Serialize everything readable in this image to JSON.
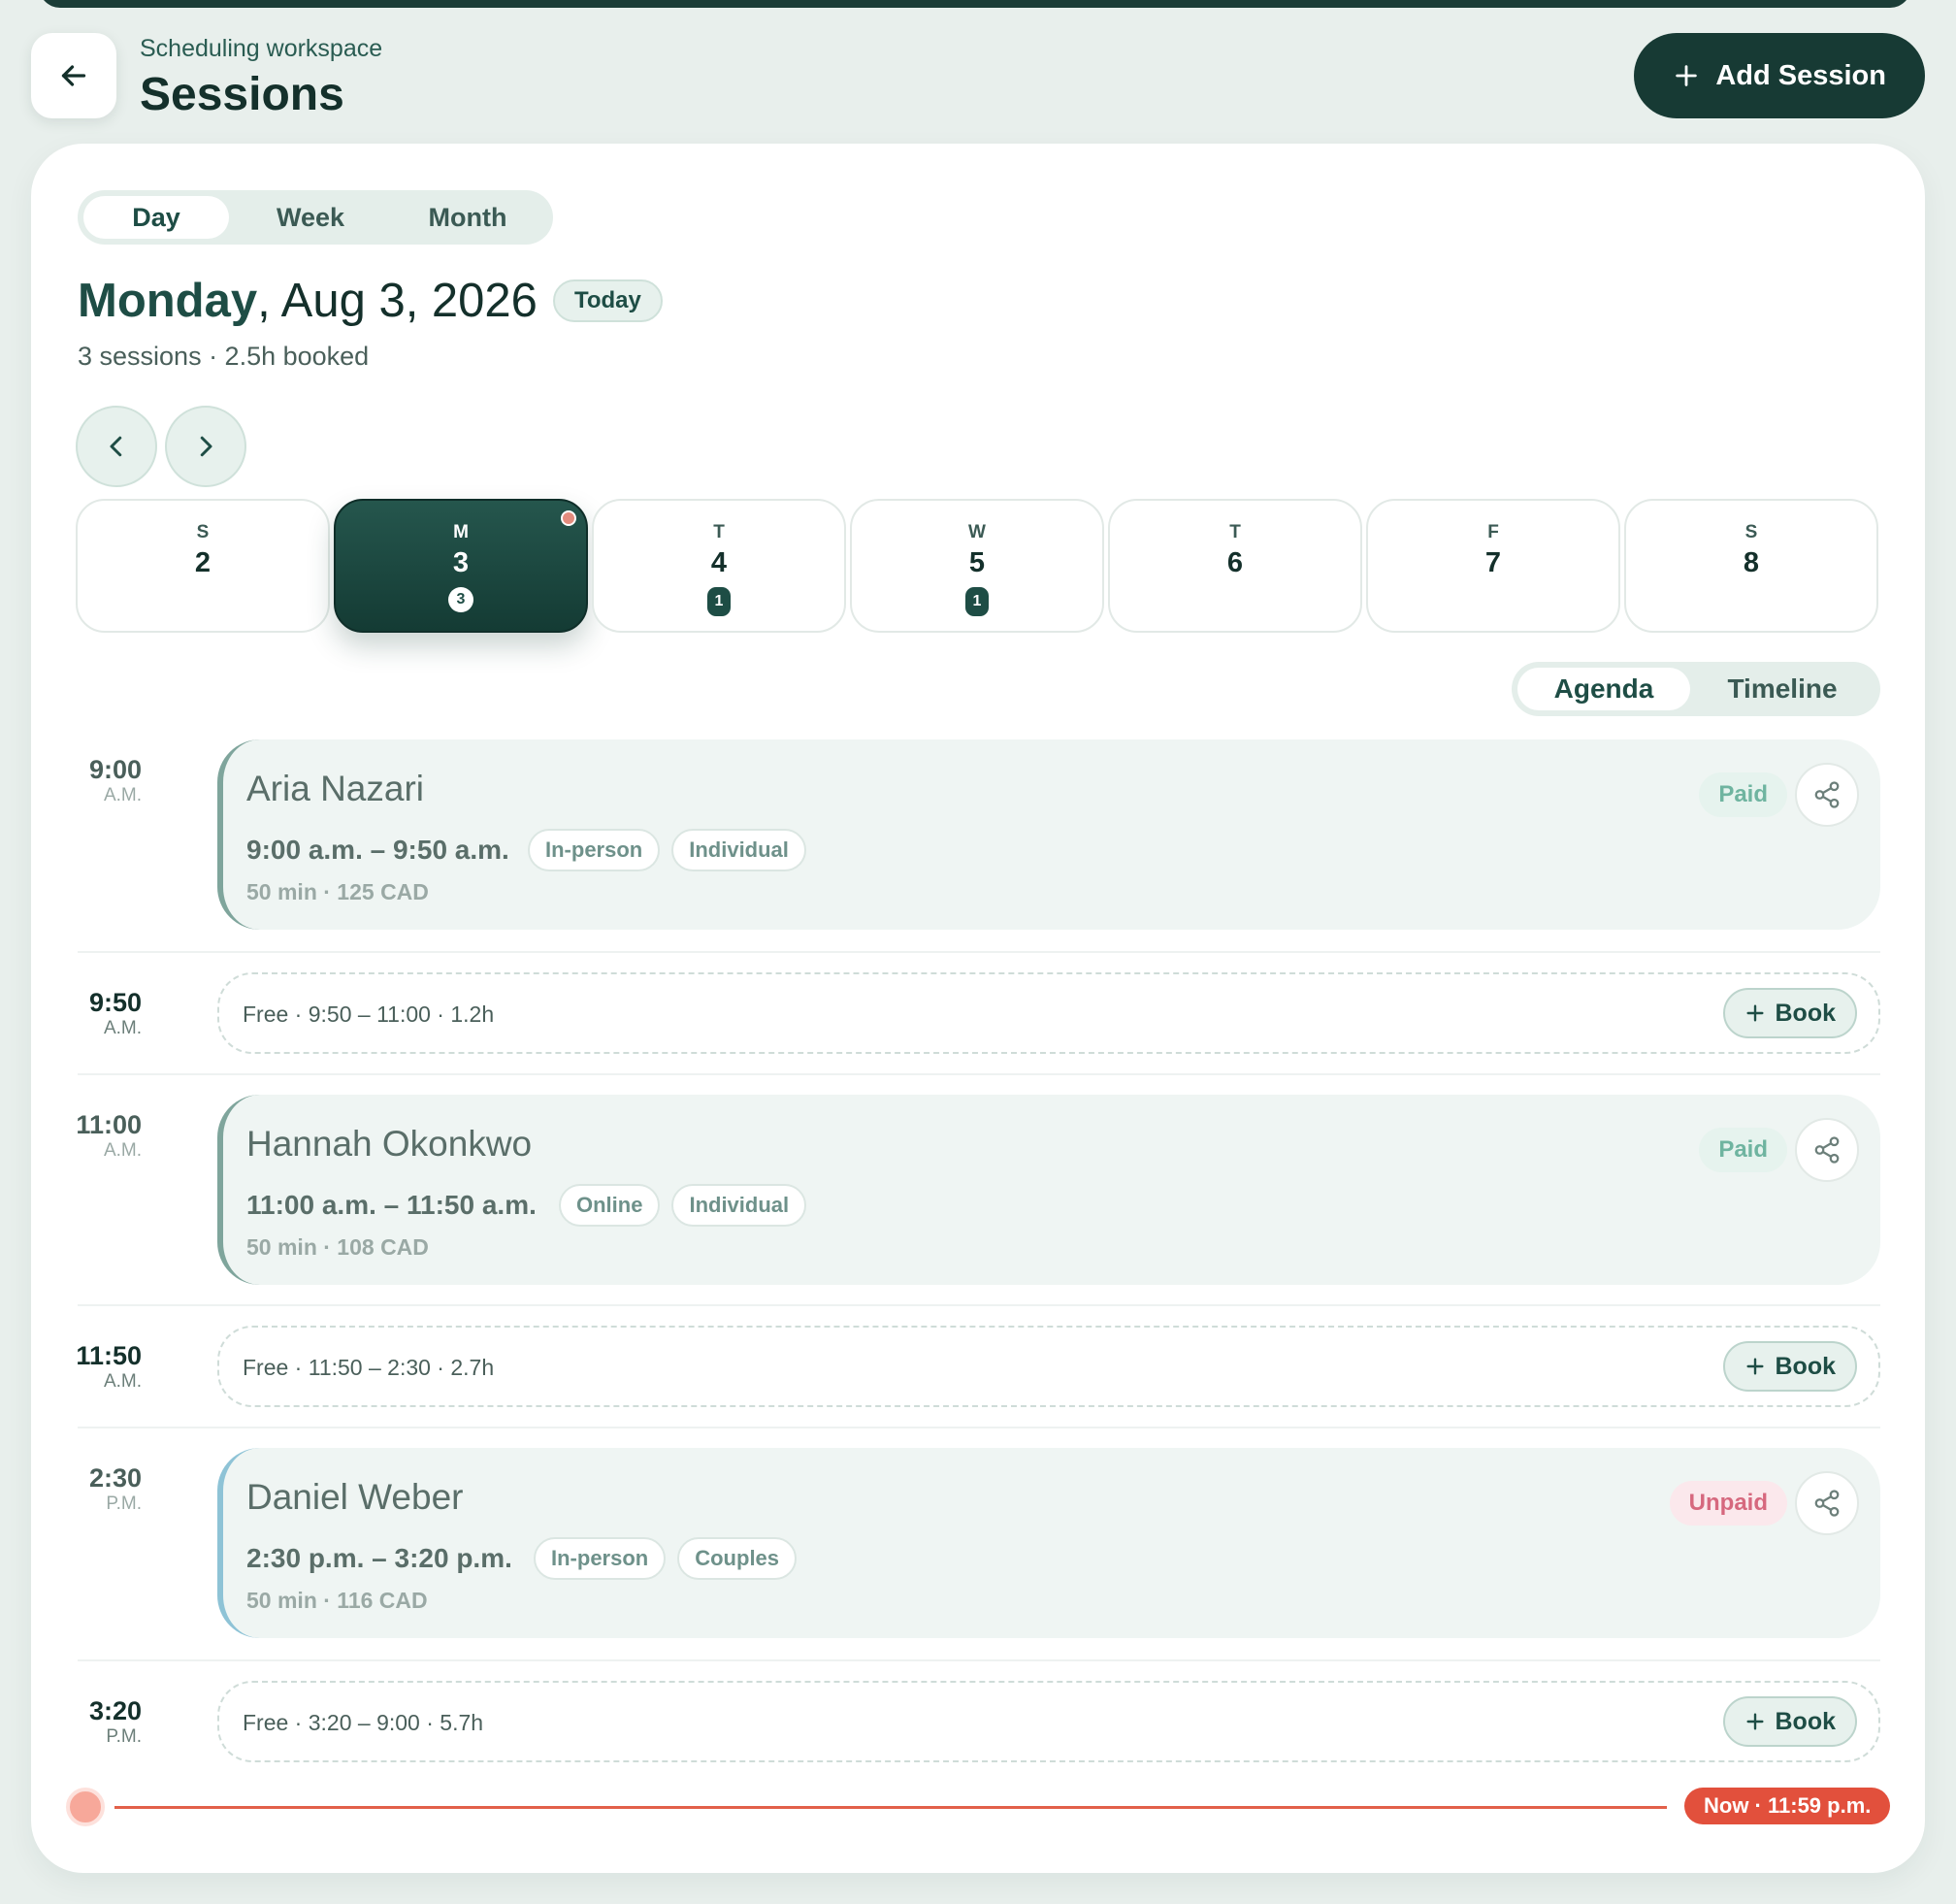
{
  "header": {
    "workspace": "Scheduling workspace",
    "title": "Sessions",
    "add_session_label": "Add Session"
  },
  "view_switch": {
    "day": "Day",
    "week": "Week",
    "month": "Month",
    "selected": "Day"
  },
  "date": {
    "weekday": "Monday",
    "rest": ", Aug 3, 2026",
    "today_badge": "Today",
    "summary": "3 sessions · 2.5h booked"
  },
  "days": [
    {
      "letter": "S",
      "num": "2",
      "count": ""
    },
    {
      "letter": "M",
      "num": "3",
      "count": "3",
      "selected": true
    },
    {
      "letter": "T",
      "num": "4",
      "count": "1"
    },
    {
      "letter": "W",
      "num": "5",
      "count": "1"
    },
    {
      "letter": "T",
      "num": "6",
      "count": ""
    },
    {
      "letter": "F",
      "num": "7",
      "count": ""
    },
    {
      "letter": "S",
      "num": "8",
      "count": ""
    }
  ],
  "mode_switch": {
    "agenda": "Agenda",
    "timeline": "Timeline",
    "selected": "Agenda"
  },
  "agenda": {
    "s1": {
      "t": "9:00",
      "ap": "A.M.",
      "name": "Aria Nazari",
      "time": "9:00 a.m. – 9:50 a.m.",
      "mode": "In-person",
      "kind": "Individual",
      "meta": "50 min · 125 CAD",
      "status": "Paid"
    },
    "f1": {
      "t": "9:50",
      "ap": "A.M.",
      "text": "Free · 9:50 – 11:00 · 1.2h",
      "book": "Book"
    },
    "s2": {
      "t": "11:00",
      "ap": "A.M.",
      "name": "Hannah Okonkwo",
      "time": "11:00 a.m. – 11:50 a.m.",
      "mode": "Online",
      "kind": "Individual",
      "meta": "50 min · 108 CAD",
      "status": "Paid"
    },
    "f2": {
      "t": "11:50",
      "ap": "A.M.",
      "text": "Free · 11:50 – 2:30 · 2.7h",
      "book": "Book"
    },
    "s3": {
      "t": "2:30",
      "ap": "P.M.",
      "name": "Daniel Weber",
      "time": "2:30 p.m. – 3:20 p.m.",
      "mode": "In-person",
      "kind": "Couples",
      "meta": "50 min · 116 CAD",
      "status": "Unpaid"
    },
    "f3": {
      "t": "3:20",
      "ap": "P.M.",
      "text": "Free · 3:20 – 9:00 · 5.7h",
      "book": "Book"
    }
  },
  "now": {
    "label": "Now · 11:59 p.m."
  },
  "colors": {
    "primary": "#173a34",
    "accent_now": "#e2503c",
    "paid": "#6fb4a0",
    "unpaid": "#d6687e"
  }
}
